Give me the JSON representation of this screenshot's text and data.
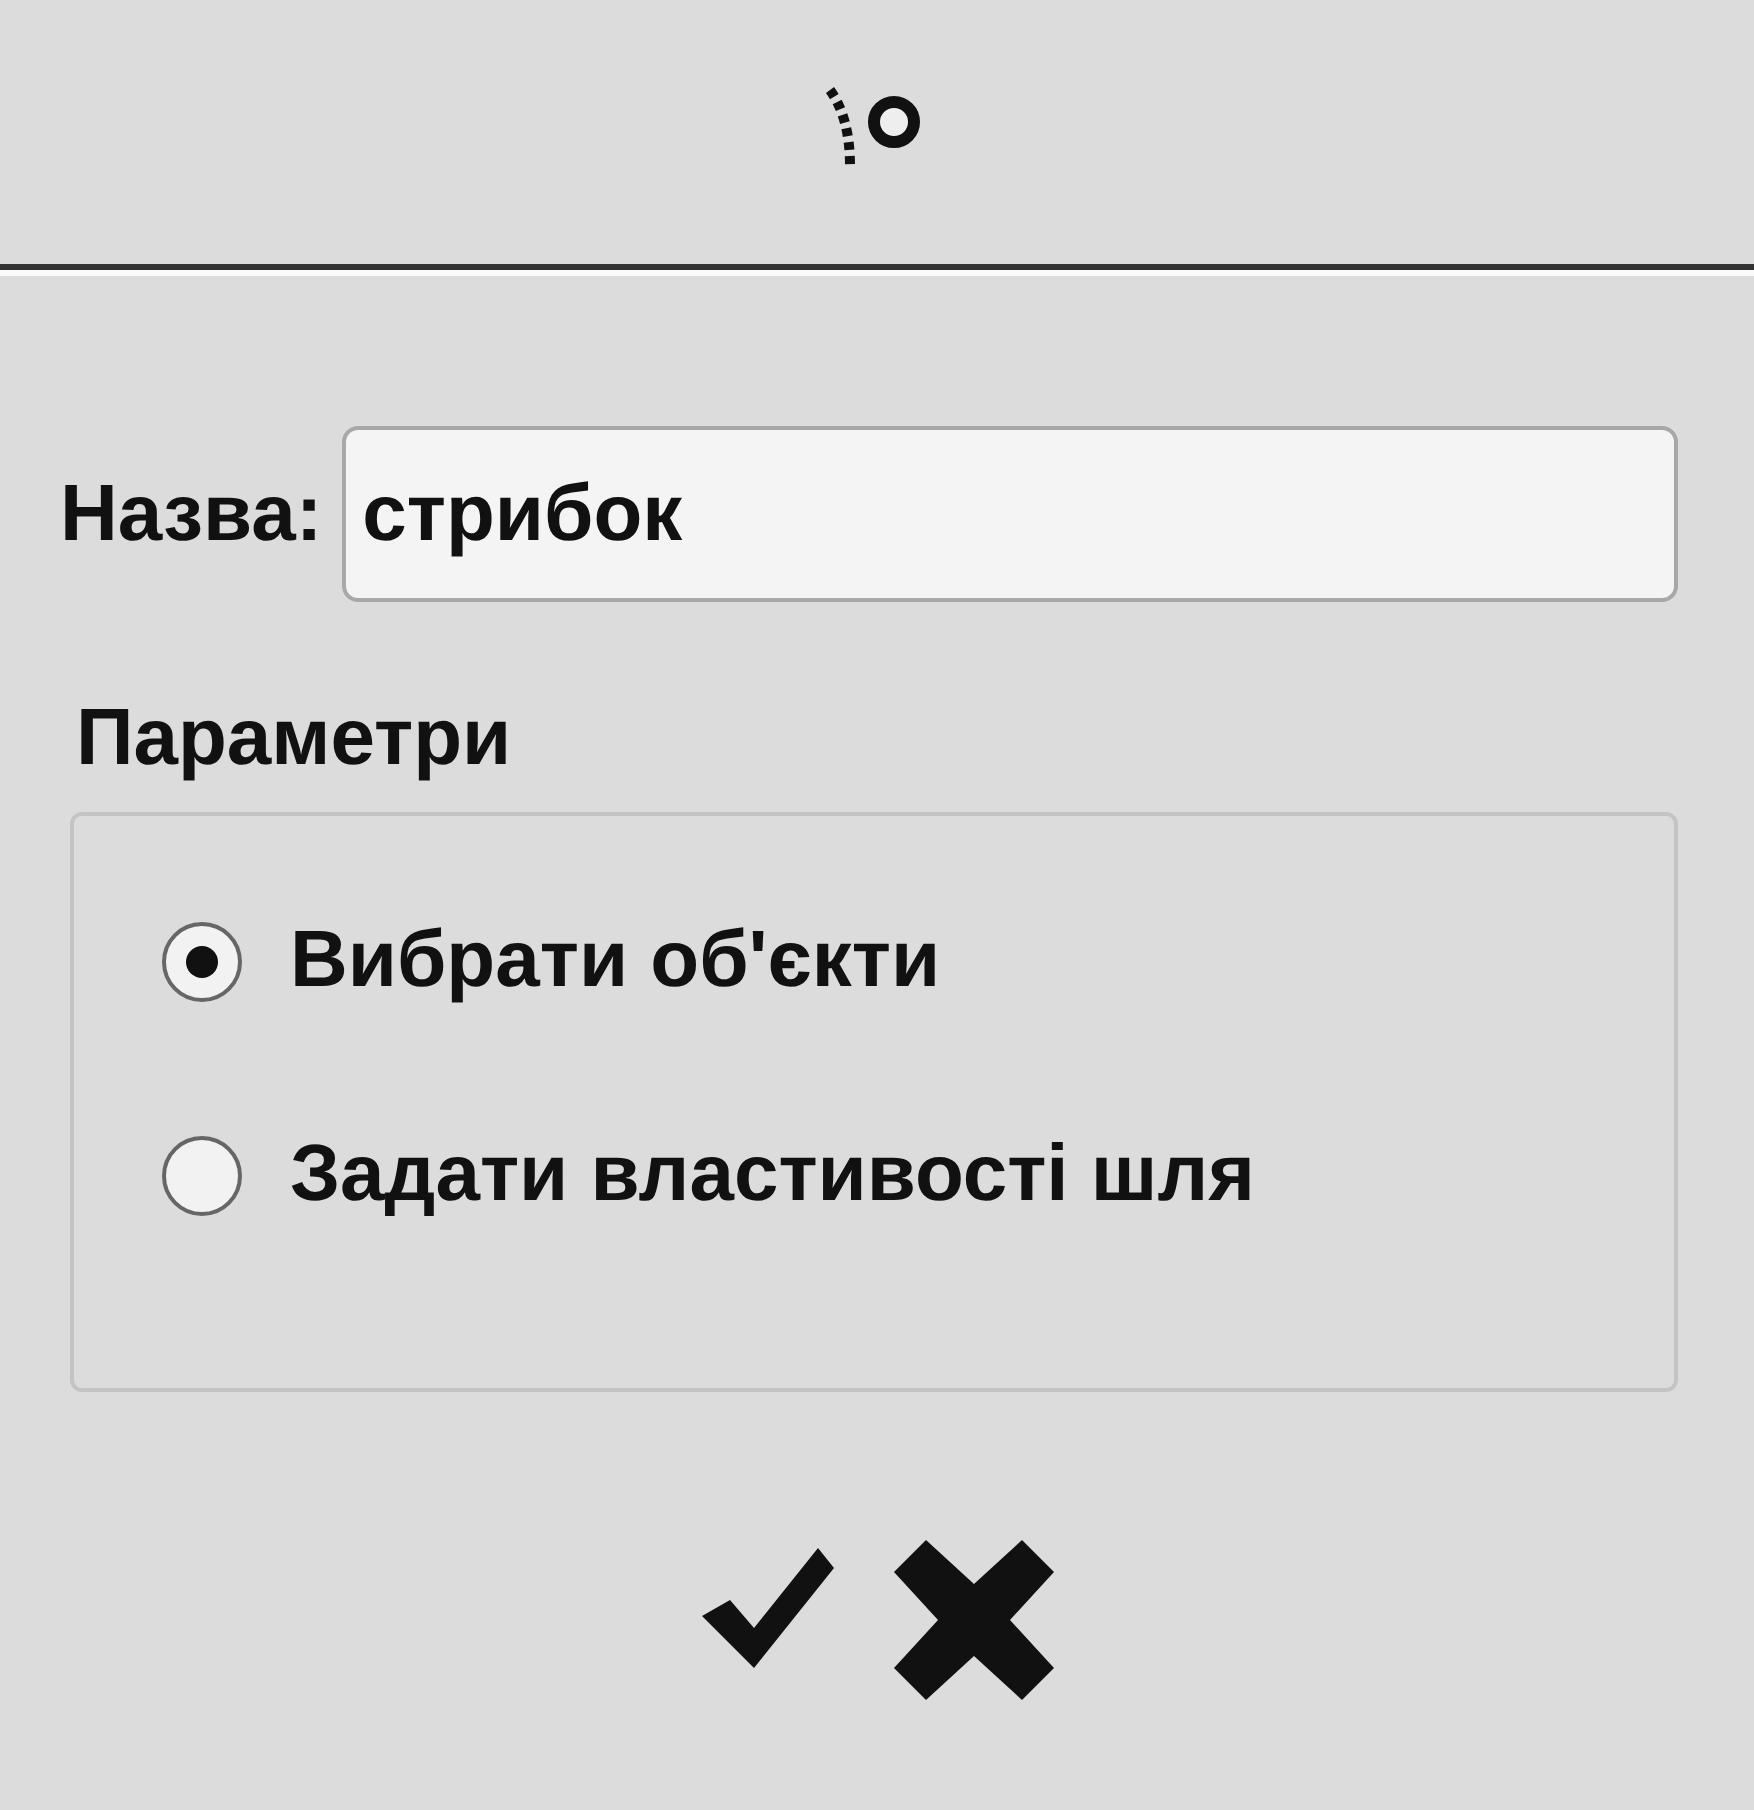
{
  "name_field": {
    "label": "Назва:",
    "value": "стрибок"
  },
  "parameters": {
    "title": "Параметри",
    "options": [
      {
        "label": "Вибрати об'єкти",
        "selected": true
      },
      {
        "label": "Задати властивості шля",
        "selected": false
      }
    ]
  }
}
